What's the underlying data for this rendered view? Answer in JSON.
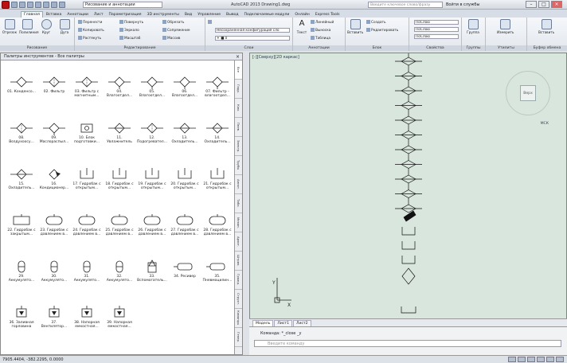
{
  "window": {
    "workspace": "Рисование и аннотации",
    "title": "AutoCAD 2013   Drawing1.dwg",
    "search_placeholder": "Введите ключевое слово/фразу",
    "signin": "Войти в службы"
  },
  "tabs": [
    "Главная",
    "Вставка",
    "Аннотации",
    "Лист",
    "Параметризация",
    "3D инструменты",
    "Вид",
    "Управление",
    "Вывод",
    "Подключаемые модули",
    "Онлайн",
    "Express Tools"
  ],
  "ribbon": {
    "panels": [
      "Рисование",
      "Редактирование",
      "Слои",
      "Аннотации",
      "Блок",
      "Свойства",
      "Группы",
      "Утилиты",
      "Буфер обмена"
    ],
    "draw": [
      "Отрезок",
      "Полилиния",
      "Круг",
      "Дуга"
    ],
    "modify": [
      "Перенести",
      "Повернуть",
      "Обрезать",
      "Копировать",
      "Зеркало",
      "Сопряжение",
      "Растянуть",
      "Масштаб",
      "Массив"
    ],
    "layers": [
      "Несохраненная конфигурация сло"
    ],
    "annot": [
      "Текст",
      "Линейный",
      "Выноска",
      "Таблица"
    ],
    "block": [
      "Вставить",
      "Создать",
      "Редактировать"
    ],
    "props": [
      "ПоСлою",
      "ПоСлою",
      "ПоСлою"
    ],
    "misc": [
      "Группа",
      "Измерить",
      "Вставить"
    ]
  },
  "palette": {
    "title": "Палитры инструментов - Все палитры",
    "vtabs": [
      "Все",
      "Гидр.",
      "Ком.",
      "Пнев.",
      "Электр.",
      "Трубы",
      "Аннот.",
      "Табл.",
      "Механ.",
      "Архит.",
      "Штрих.",
      "Гражд.",
      "Структ.",
      "Команды",
      "Генер."
    ],
    "items": [
      {
        "label": "01. Конденсо...",
        "icon": "diamond-valve-icon"
      },
      {
        "label": "02. Фильтр",
        "icon": "filter-icon"
      },
      {
        "label": "03. Фильтр с магнитным...",
        "icon": "magnetic-filter-icon"
      },
      {
        "label": "04. Влагоотдел...",
        "icon": "moisture-separator-icon"
      },
      {
        "label": "05. Влагоотдел...",
        "icon": "moisture-separator-icon"
      },
      {
        "label": "06. Влагоотдел...",
        "icon": "moisture-separator-icon"
      },
      {
        "label": "07. Фильтр - влагоотдел...",
        "icon": "filter-separator-icon"
      },
      {
        "label": "08. Воздухоосу...",
        "icon": "air-dryer-icon"
      },
      {
        "label": "09. Маслораспыл...",
        "icon": "lubricator-icon"
      },
      {
        "label": "10. Блок подготовки...",
        "icon": "prep-unit-icon"
      },
      {
        "label": "11. Увлажнитель",
        "icon": "humidifier-icon"
      },
      {
        "label": "12. Подогревател...",
        "icon": "heater-icon"
      },
      {
        "label": "13. Охладитель...",
        "icon": "cooler-icon"
      },
      {
        "label": "14. Охладитель...",
        "icon": "cooler-icon"
      },
      {
        "label": "15. Охладитель...",
        "icon": "cooler-icon"
      },
      {
        "label": "16. Кондиционер...",
        "icon": "conditioner-icon"
      },
      {
        "label": "17. Гидробак с открытым...",
        "icon": "open-tank-icon"
      },
      {
        "label": "18. Гидробак с открытым...",
        "icon": "open-tank-icon"
      },
      {
        "label": "19. Гидробак с открытым...",
        "icon": "open-tank-icon"
      },
      {
        "label": "20. Гидробак с открытым...",
        "icon": "open-tank-icon"
      },
      {
        "label": "21. Гидробак с открытым...",
        "icon": "open-tank-icon"
      },
      {
        "label": "22. Гидробак с закрытым...",
        "icon": "closed-tank-icon"
      },
      {
        "label": "23. Гидробак с давлением в...",
        "icon": "pressure-tank-icon"
      },
      {
        "label": "24. Гидробак с давлением в...",
        "icon": "pressure-tank-icon"
      },
      {
        "label": "25. Гидробак с давлением в...",
        "icon": "pressure-tank-icon"
      },
      {
        "label": "26. Гидробак с давлением в...",
        "icon": "pressure-tank-icon"
      },
      {
        "label": "27. Гидробак с давлением в...",
        "icon": "pressure-tank-icon"
      },
      {
        "label": "28. Гидробак с давлением в...",
        "icon": "pressure-tank-icon"
      },
      {
        "label": "29. Аккумулято...",
        "icon": "accumulator-icon"
      },
      {
        "label": "30. Аккумулято...",
        "icon": "accumulator-icon"
      },
      {
        "label": "31. Аккумулято...",
        "icon": "accumulator-icon"
      },
      {
        "label": "32. Аккумулято...",
        "icon": "accumulator-icon"
      },
      {
        "label": "33. Вспомогатель...",
        "icon": "aux-icon"
      },
      {
        "label": "34. Ресивер",
        "icon": "receiver-icon"
      },
      {
        "label": "35. Пневмоцилин...",
        "icon": "cylinder-icon"
      },
      {
        "label": "36. Заливная горловина",
        "icon": "filler-icon"
      },
      {
        "label": "37. Вентилятор...",
        "icon": "fan-icon"
      },
      {
        "label": "38. Напорная емкостная...",
        "icon": "pressure-vessel-icon"
      },
      {
        "label": "39. Напорная емкостная...",
        "icon": "pressure-vessel-icon"
      }
    ]
  },
  "viewport": {
    "label": "[-][Сверху][2D каркас]",
    "cube_face": "Верх",
    "wcs": "МСК",
    "axis_y": "Y",
    "axis_x": "X"
  },
  "layout_tabs": [
    "Модель",
    "Лист1",
    "Лист2"
  ],
  "command": {
    "history": "Команда: *_close _y",
    "prompt": "Введите команду"
  },
  "status": {
    "coords": "7905.4404, -382.2295, 0.0000"
  }
}
